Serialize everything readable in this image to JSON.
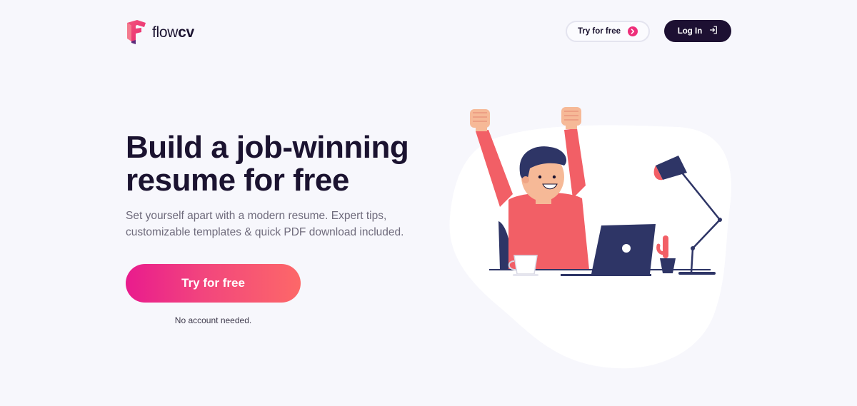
{
  "header": {
    "logo": {
      "prefix": "flow",
      "suffix": "cv"
    },
    "nav": {
      "try_label": "Try for free",
      "login_label": "Log In"
    }
  },
  "hero": {
    "headline_line1": "Build a job-winning",
    "headline_line2": "resume for free",
    "subtext_line1": "Set yourself apart with a modern resume. Expert tips,",
    "subtext_line2": "customizable templates & quick PDF download included.",
    "cta_label": "Try for free",
    "cta_note": "No account needed."
  },
  "colors": {
    "brand_dark": "#1d1032",
    "accent_pink": "#ee2f7a",
    "gradient_start": "#e91b8d",
    "gradient_end": "#fd6868",
    "background": "#f7f7fc"
  },
  "icons": {
    "logo": "flowcv-logo-icon",
    "try_arrow": "arrow-right-icon",
    "login": "login-icon"
  }
}
